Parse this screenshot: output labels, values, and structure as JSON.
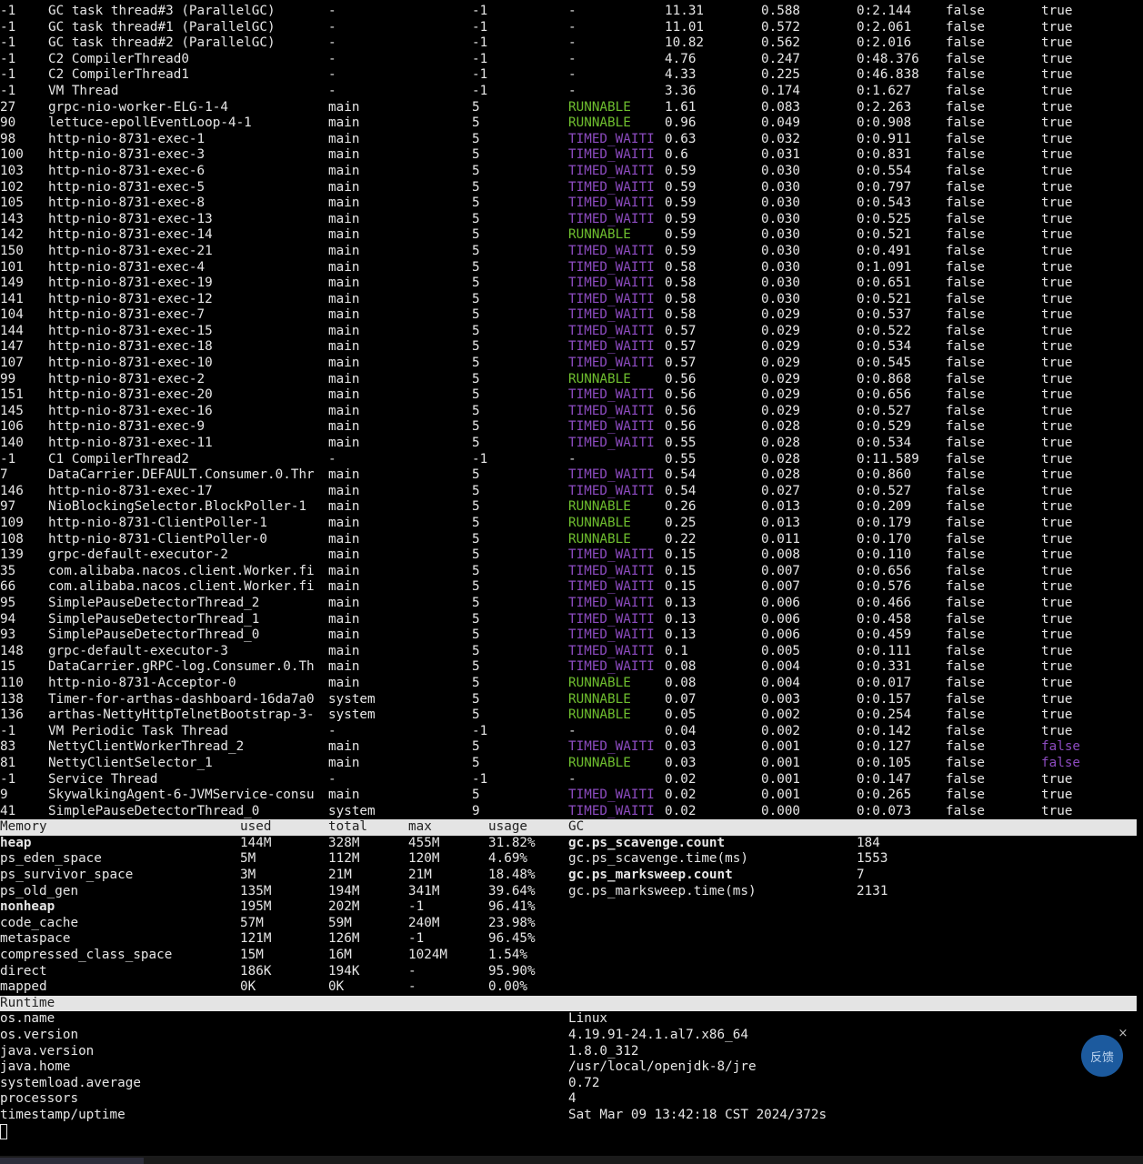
{
  "threads": [
    {
      "id": "-1",
      "name": "GC task thread#3 (ParallelGC)",
      "group": "-",
      "priority": "-1",
      "state": "-",
      "cpu": "11.31",
      "delta_time": "0.588",
      "time": "0:2.144",
      "interrupted": "false",
      "daemon": "true"
    },
    {
      "id": "-1",
      "name": "GC task thread#1 (ParallelGC)",
      "group": "-",
      "priority": "-1",
      "state": "-",
      "cpu": "11.01",
      "delta_time": "0.572",
      "time": "0:2.061",
      "interrupted": "false",
      "daemon": "true"
    },
    {
      "id": "-1",
      "name": "GC task thread#2 (ParallelGC)",
      "group": "-",
      "priority": "-1",
      "state": "-",
      "cpu": "10.82",
      "delta_time": "0.562",
      "time": "0:2.016",
      "interrupted": "false",
      "daemon": "true"
    },
    {
      "id": "-1",
      "name": "C2 CompilerThread0",
      "group": "-",
      "priority": "-1",
      "state": "-",
      "cpu": "4.76",
      "delta_time": "0.247",
      "time": "0:48.376",
      "interrupted": "false",
      "daemon": "true"
    },
    {
      "id": "-1",
      "name": "C2 CompilerThread1",
      "group": "-",
      "priority": "-1",
      "state": "-",
      "cpu": "4.33",
      "delta_time": "0.225",
      "time": "0:46.838",
      "interrupted": "false",
      "daemon": "true"
    },
    {
      "id": "-1",
      "name": "VM Thread",
      "group": "-",
      "priority": "-1",
      "state": "-",
      "cpu": "3.36",
      "delta_time": "0.174",
      "time": "0:1.627",
      "interrupted": "false",
      "daemon": "true"
    },
    {
      "id": "27",
      "name": "grpc-nio-worker-ELG-1-4",
      "group": "main",
      "priority": "5",
      "state": "RUNNABLE",
      "cpu": "1.61",
      "delta_time": "0.083",
      "time": "0:2.263",
      "interrupted": "false",
      "daemon": "true"
    },
    {
      "id": "90",
      "name": "lettuce-epollEventLoop-4-1",
      "group": "main",
      "priority": "5",
      "state": "RUNNABLE",
      "cpu": "0.96",
      "delta_time": "0.049",
      "time": "0:0.908",
      "interrupted": "false",
      "daemon": "true"
    },
    {
      "id": "98",
      "name": "http-nio-8731-exec-1",
      "group": "main",
      "priority": "5",
      "state": "TIMED_WAITI",
      "cpu": "0.63",
      "delta_time": "0.032",
      "time": "0:0.911",
      "interrupted": "false",
      "daemon": "true"
    },
    {
      "id": "100",
      "name": "http-nio-8731-exec-3",
      "group": "main",
      "priority": "5",
      "state": "TIMED_WAITI",
      "cpu": "0.6",
      "delta_time": "0.031",
      "time": "0:0.831",
      "interrupted": "false",
      "daemon": "true"
    },
    {
      "id": "103",
      "name": "http-nio-8731-exec-6",
      "group": "main",
      "priority": "5",
      "state": "TIMED_WAITI",
      "cpu": "0.59",
      "delta_time": "0.030",
      "time": "0:0.554",
      "interrupted": "false",
      "daemon": "true"
    },
    {
      "id": "102",
      "name": "http-nio-8731-exec-5",
      "group": "main",
      "priority": "5",
      "state": "TIMED_WAITI",
      "cpu": "0.59",
      "delta_time": "0.030",
      "time": "0:0.797",
      "interrupted": "false",
      "daemon": "true"
    },
    {
      "id": "105",
      "name": "http-nio-8731-exec-8",
      "group": "main",
      "priority": "5",
      "state": "TIMED_WAITI",
      "cpu": "0.59",
      "delta_time": "0.030",
      "time": "0:0.543",
      "interrupted": "false",
      "daemon": "true"
    },
    {
      "id": "143",
      "name": "http-nio-8731-exec-13",
      "group": "main",
      "priority": "5",
      "state": "TIMED_WAITI",
      "cpu": "0.59",
      "delta_time": "0.030",
      "time": "0:0.525",
      "interrupted": "false",
      "daemon": "true"
    },
    {
      "id": "142",
      "name": "http-nio-8731-exec-14",
      "group": "main",
      "priority": "5",
      "state": "RUNNABLE",
      "cpu": "0.59",
      "delta_time": "0.030",
      "time": "0:0.521",
      "interrupted": "false",
      "daemon": "true"
    },
    {
      "id": "150",
      "name": "http-nio-8731-exec-21",
      "group": "main",
      "priority": "5",
      "state": "TIMED_WAITI",
      "cpu": "0.59",
      "delta_time": "0.030",
      "time": "0:0.491",
      "interrupted": "false",
      "daemon": "true"
    },
    {
      "id": "101",
      "name": "http-nio-8731-exec-4",
      "group": "main",
      "priority": "5",
      "state": "TIMED_WAITI",
      "cpu": "0.58",
      "delta_time": "0.030",
      "time": "0:1.091",
      "interrupted": "false",
      "daemon": "true"
    },
    {
      "id": "149",
      "name": "http-nio-8731-exec-19",
      "group": "main",
      "priority": "5",
      "state": "TIMED_WAITI",
      "cpu": "0.58",
      "delta_time": "0.030",
      "time": "0:0.651",
      "interrupted": "false",
      "daemon": "true"
    },
    {
      "id": "141",
      "name": "http-nio-8731-exec-12",
      "group": "main",
      "priority": "5",
      "state": "TIMED_WAITI",
      "cpu": "0.58",
      "delta_time": "0.030",
      "time": "0:0.521",
      "interrupted": "false",
      "daemon": "true"
    },
    {
      "id": "104",
      "name": "http-nio-8731-exec-7",
      "group": "main",
      "priority": "5",
      "state": "TIMED_WAITI",
      "cpu": "0.58",
      "delta_time": "0.029",
      "time": "0:0.537",
      "interrupted": "false",
      "daemon": "true"
    },
    {
      "id": "144",
      "name": "http-nio-8731-exec-15",
      "group": "main",
      "priority": "5",
      "state": "TIMED_WAITI",
      "cpu": "0.57",
      "delta_time": "0.029",
      "time": "0:0.522",
      "interrupted": "false",
      "daemon": "true"
    },
    {
      "id": "147",
      "name": "http-nio-8731-exec-18",
      "group": "main",
      "priority": "5",
      "state": "TIMED_WAITI",
      "cpu": "0.57",
      "delta_time": "0.029",
      "time": "0:0.534",
      "interrupted": "false",
      "daemon": "true"
    },
    {
      "id": "107",
      "name": "http-nio-8731-exec-10",
      "group": "main",
      "priority": "5",
      "state": "TIMED_WAITI",
      "cpu": "0.57",
      "delta_time": "0.029",
      "time": "0:0.545",
      "interrupted": "false",
      "daemon": "true"
    },
    {
      "id": "99",
      "name": "http-nio-8731-exec-2",
      "group": "main",
      "priority": "5",
      "state": "RUNNABLE",
      "cpu": "0.56",
      "delta_time": "0.029",
      "time": "0:0.868",
      "interrupted": "false",
      "daemon": "true"
    },
    {
      "id": "151",
      "name": "http-nio-8731-exec-20",
      "group": "main",
      "priority": "5",
      "state": "TIMED_WAITI",
      "cpu": "0.56",
      "delta_time": "0.029",
      "time": "0:0.656",
      "interrupted": "false",
      "daemon": "true"
    },
    {
      "id": "145",
      "name": "http-nio-8731-exec-16",
      "group": "main",
      "priority": "5",
      "state": "TIMED_WAITI",
      "cpu": "0.56",
      "delta_time": "0.029",
      "time": "0:0.527",
      "interrupted": "false",
      "daemon": "true"
    },
    {
      "id": "106",
      "name": "http-nio-8731-exec-9",
      "group": "main",
      "priority": "5",
      "state": "TIMED_WAITI",
      "cpu": "0.56",
      "delta_time": "0.028",
      "time": "0:0.529",
      "interrupted": "false",
      "daemon": "true"
    },
    {
      "id": "140",
      "name": "http-nio-8731-exec-11",
      "group": "main",
      "priority": "5",
      "state": "TIMED_WAITI",
      "cpu": "0.55",
      "delta_time": "0.028",
      "time": "0:0.534",
      "interrupted": "false",
      "daemon": "true"
    },
    {
      "id": "-1",
      "name": "C1 CompilerThread2",
      "group": "-",
      "priority": "-1",
      "state": "-",
      "cpu": "0.55",
      "delta_time": "0.028",
      "time": "0:11.589",
      "interrupted": "false",
      "daemon": "true"
    },
    {
      "id": "7",
      "name": "DataCarrier.DEFAULT.Consumer.0.Thr",
      "group": "main",
      "priority": "5",
      "state": "TIMED_WAITI",
      "cpu": "0.54",
      "delta_time": "0.028",
      "time": "0:0.860",
      "interrupted": "false",
      "daemon": "true"
    },
    {
      "id": "146",
      "name": "http-nio-8731-exec-17",
      "group": "main",
      "priority": "5",
      "state": "TIMED_WAITI",
      "cpu": "0.54",
      "delta_time": "0.027",
      "time": "0:0.527",
      "interrupted": "false",
      "daemon": "true"
    },
    {
      "id": "97",
      "name": "NioBlockingSelector.BlockPoller-1",
      "group": "main",
      "priority": "5",
      "state": "RUNNABLE",
      "cpu": "0.26",
      "delta_time": "0.013",
      "time": "0:0.209",
      "interrupted": "false",
      "daemon": "true"
    },
    {
      "id": "109",
      "name": "http-nio-8731-ClientPoller-1",
      "group": "main",
      "priority": "5",
      "state": "RUNNABLE",
      "cpu": "0.25",
      "delta_time": "0.013",
      "time": "0:0.179",
      "interrupted": "false",
      "daemon": "true"
    },
    {
      "id": "108",
      "name": "http-nio-8731-ClientPoller-0",
      "group": "main",
      "priority": "5",
      "state": "RUNNABLE",
      "cpu": "0.22",
      "delta_time": "0.011",
      "time": "0:0.170",
      "interrupted": "false",
      "daemon": "true"
    },
    {
      "id": "139",
      "name": "grpc-default-executor-2",
      "group": "main",
      "priority": "5",
      "state": "TIMED_WAITI",
      "cpu": "0.15",
      "delta_time": "0.008",
      "time": "0:0.110",
      "interrupted": "false",
      "daemon": "true"
    },
    {
      "id": "35",
      "name": "com.alibaba.nacos.client.Worker.fi",
      "group": "main",
      "priority": "5",
      "state": "TIMED_WAITI",
      "cpu": "0.15",
      "delta_time": "0.007",
      "time": "0:0.656",
      "interrupted": "false",
      "daemon": "true"
    },
    {
      "id": "66",
      "name": "com.alibaba.nacos.client.Worker.fi",
      "group": "main",
      "priority": "5",
      "state": "TIMED_WAITI",
      "cpu": "0.15",
      "delta_time": "0.007",
      "time": "0:0.576",
      "interrupted": "false",
      "daemon": "true"
    },
    {
      "id": "95",
      "name": "SimplePauseDetectorThread_2",
      "group": "main",
      "priority": "5",
      "state": "TIMED_WAITI",
      "cpu": "0.13",
      "delta_time": "0.006",
      "time": "0:0.466",
      "interrupted": "false",
      "daemon": "true"
    },
    {
      "id": "94",
      "name": "SimplePauseDetectorThread_1",
      "group": "main",
      "priority": "5",
      "state": "TIMED_WAITI",
      "cpu": "0.13",
      "delta_time": "0.006",
      "time": "0:0.458",
      "interrupted": "false",
      "daemon": "true"
    },
    {
      "id": "93",
      "name": "SimplePauseDetectorThread_0",
      "group": "main",
      "priority": "5",
      "state": "TIMED_WAITI",
      "cpu": "0.13",
      "delta_time": "0.006",
      "time": "0:0.459",
      "interrupted": "false",
      "daemon": "true"
    },
    {
      "id": "148",
      "name": "grpc-default-executor-3",
      "group": "main",
      "priority": "5",
      "state": "TIMED_WAITI",
      "cpu": "0.1",
      "delta_time": "0.005",
      "time": "0:0.111",
      "interrupted": "false",
      "daemon": "true"
    },
    {
      "id": "15",
      "name": "DataCarrier.gRPC-log.Consumer.0.Th",
      "group": "main",
      "priority": "5",
      "state": "TIMED_WAITI",
      "cpu": "0.08",
      "delta_time": "0.004",
      "time": "0:0.331",
      "interrupted": "false",
      "daemon": "true"
    },
    {
      "id": "110",
      "name": "http-nio-8731-Acceptor-0",
      "group": "main",
      "priority": "5",
      "state": "RUNNABLE",
      "cpu": "0.08",
      "delta_time": "0.004",
      "time": "0:0.017",
      "interrupted": "false",
      "daemon": "true"
    },
    {
      "id": "138",
      "name": "Timer-for-arthas-dashboard-16da7a0",
      "group": "system",
      "priority": "5",
      "state": "RUNNABLE",
      "cpu": "0.07",
      "delta_time": "0.003",
      "time": "0:0.157",
      "interrupted": "false",
      "daemon": "true"
    },
    {
      "id": "136",
      "name": "arthas-NettyHttpTelnetBootstrap-3-",
      "group": "system",
      "priority": "5",
      "state": "RUNNABLE",
      "cpu": "0.05",
      "delta_time": "0.002",
      "time": "0:0.254",
      "interrupted": "false",
      "daemon": "true"
    },
    {
      "id": "-1",
      "name": "VM Periodic Task Thread",
      "group": "-",
      "priority": "-1",
      "state": "-",
      "cpu": "0.04",
      "delta_time": "0.002",
      "time": "0:0.142",
      "interrupted": "false",
      "daemon": "true"
    },
    {
      "id": "83",
      "name": "NettyClientWorkerThread_2",
      "group": "main",
      "priority": "5",
      "state": "TIMED_WAITI",
      "cpu": "0.03",
      "delta_time": "0.001",
      "time": "0:0.127",
      "interrupted": "false",
      "daemon": "false"
    },
    {
      "id": "81",
      "name": "NettyClientSelector_1",
      "group": "main",
      "priority": "5",
      "state": "RUNNABLE",
      "cpu": "0.03",
      "delta_time": "0.001",
      "time": "0:0.105",
      "interrupted": "false",
      "daemon": "false"
    },
    {
      "id": "-1",
      "name": "Service Thread",
      "group": "-",
      "priority": "-1",
      "state": "-",
      "cpu": "0.02",
      "delta_time": "0.001",
      "time": "0:0.147",
      "interrupted": "false",
      "daemon": "true"
    },
    {
      "id": "9",
      "name": "SkywalkingAgent-6-JVMService-consu",
      "group": "main",
      "priority": "5",
      "state": "TIMED_WAITI",
      "cpu": "0.02",
      "delta_time": "0.001",
      "time": "0:0.265",
      "interrupted": "false",
      "daemon": "true"
    },
    {
      "id": "41",
      "name": "SimplePauseDetectorThread_0",
      "group": "system",
      "priority": "9",
      "state": "TIMED_WAITI",
      "cpu": "0.02",
      "delta_time": "0.000",
      "time": "0:0.073",
      "interrupted": "false",
      "daemon": "true"
    }
  ],
  "memory": {
    "headers": {
      "memory": "Memory",
      "used": "used",
      "total": "total",
      "max": "max",
      "usage": "usage",
      "gc": "GC"
    },
    "rows": [
      {
        "name": "heap",
        "used": "144M",
        "total": "328M",
        "max": "455M",
        "usage": "31.82%",
        "bold": true
      },
      {
        "name": "ps_eden_space",
        "used": "5M",
        "total": "112M",
        "max": "120M",
        "usage": "4.69%",
        "bold": false
      },
      {
        "name": "ps_survivor_space",
        "used": "3M",
        "total": "21M",
        "max": "21M",
        "usage": "18.48%",
        "bold": false
      },
      {
        "name": "ps_old_gen",
        "used": "135M",
        "total": "194M",
        "max": "341M",
        "usage": "39.64%",
        "bold": false
      },
      {
        "name": "nonheap",
        "used": "195M",
        "total": "202M",
        "max": "-1",
        "usage": "96.41%",
        "bold": true
      },
      {
        "name": "code_cache",
        "used": "57M",
        "total": "59M",
        "max": "240M",
        "usage": "23.98%",
        "bold": false
      },
      {
        "name": "metaspace",
        "used": "121M",
        "total": "126M",
        "max": "-1",
        "usage": "96.45%",
        "bold": false
      },
      {
        "name": "compressed_class_space",
        "used": "15M",
        "total": "16M",
        "max": "1024M",
        "usage": "1.54%",
        "bold": false
      },
      {
        "name": "direct",
        "used": "186K",
        "total": "194K",
        "max": "-",
        "usage": "95.90%",
        "bold": false
      },
      {
        "name": "mapped",
        "used": "0K",
        "total": "0K",
        "max": "-",
        "usage": "0.00%",
        "bold": false
      }
    ],
    "gc": [
      {
        "name": "gc.ps_scavenge.count",
        "value": "184",
        "bold": true
      },
      {
        "name": "gc.ps_scavenge.time(ms)",
        "value": "1553",
        "bold": false
      },
      {
        "name": "gc.ps_marksweep.count",
        "value": "7",
        "bold": true
      },
      {
        "name": "gc.ps_marksweep.time(ms)",
        "value": "2131",
        "bold": false
      }
    ]
  },
  "runtime": {
    "header": "Runtime",
    "rows": [
      {
        "name": "os.name",
        "value": "Linux"
      },
      {
        "name": "os.version",
        "value": "4.19.91-24.1.al7.x86_64"
      },
      {
        "name": "java.version",
        "value": "1.8.0_312"
      },
      {
        "name": "java.home",
        "value": "/usr/local/openjdk-8/jre"
      },
      {
        "name": "systemload.average",
        "value": "0.72"
      },
      {
        "name": "processors",
        "value": "4"
      },
      {
        "name": "timestamp/uptime",
        "value": "Sat Mar 09 13:42:18 CST 2024/372s"
      }
    ]
  },
  "feedback": {
    "label": "反馈",
    "close": "×"
  },
  "colors": {
    "runnable": "#6fbf2f",
    "timed_waiting": "#8c4bbf",
    "header_bg": "#e4e4e4",
    "feedback_bg": "#1c5a9e"
  }
}
